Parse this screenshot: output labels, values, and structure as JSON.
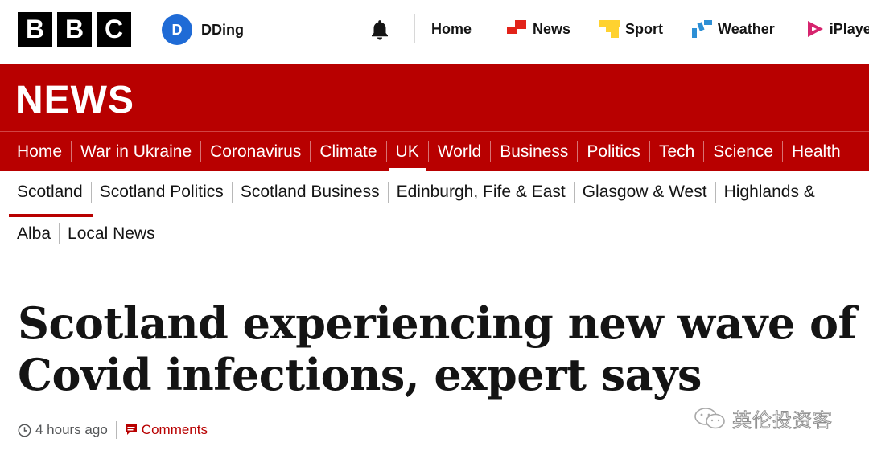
{
  "brand": {
    "blocks": [
      "B",
      "B",
      "C"
    ]
  },
  "account": {
    "initial": "D",
    "name": "DDing"
  },
  "topnav": {
    "items": [
      {
        "label": "Home",
        "icon": "none"
      },
      {
        "label": "News",
        "icon": "news-icon",
        "color": "#e2231a"
      },
      {
        "label": "Sport",
        "icon": "sport-icon",
        "color": "#ffd230"
      },
      {
        "label": "Weather",
        "icon": "weather-icon",
        "color": "#2d8fd5"
      },
      {
        "label": "iPlayer",
        "icon": "iplayer-icon",
        "color": "#d6246e"
      }
    ]
  },
  "banner": {
    "title": "NEWS",
    "color": "#b80000"
  },
  "section_nav": {
    "items": [
      "Home",
      "War in Ukraine",
      "Coronavirus",
      "Climate",
      "UK",
      "World",
      "Business",
      "Politics",
      "Tech",
      "Science",
      "Health"
    ],
    "active": "UK"
  },
  "sub_nav": {
    "row1": [
      "Scotland",
      "Scotland Politics",
      "Scotland Business",
      "Edinburgh, Fife & East",
      "Glasgow & West",
      "Highlands &"
    ],
    "row2": [
      "Alba",
      "Local News"
    ],
    "active": "Scotland"
  },
  "article": {
    "headline_line1": "Scotland experiencing new wave of",
    "headline_line2": "Covid infections, expert says",
    "time": "4 hours ago",
    "comments_label": "Comments"
  },
  "watermark": {
    "text": "英伦投资客"
  }
}
